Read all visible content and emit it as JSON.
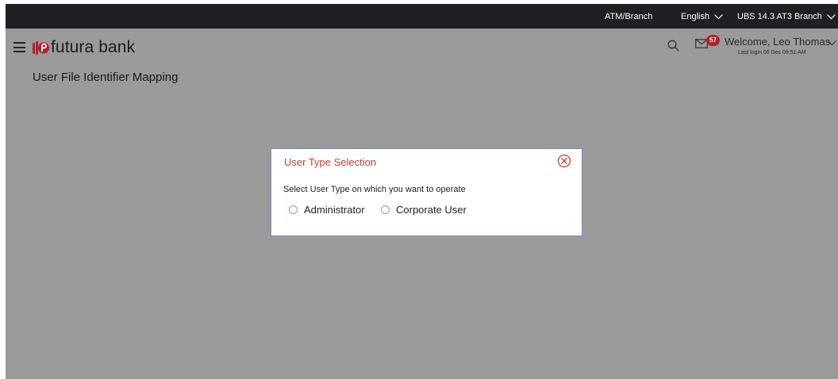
{
  "topbar": {
    "atm_branch": "ATM/Branch",
    "language": "English",
    "branch": "UBS 14.3 AT3 Branch"
  },
  "header": {
    "brand": "futura bank",
    "notification_count": "57",
    "welcome": "Welcome, Leo Thomas",
    "last_login": "Last login 06 Dec 09:51 AM",
    "icons": [
      "menu-icon",
      "logo-icon",
      "search-icon",
      "mail-icon",
      "chevron-down-icon"
    ]
  },
  "page": {
    "title": "User File Identifier Mapping"
  },
  "modal": {
    "title": "User Type Selection",
    "description": "Select User Type on which you want to operate",
    "options": [
      "Administrator",
      "Corporate User"
    ],
    "accent_color": "#c4402f"
  },
  "colors": {
    "topbar": "#1f1f24",
    "overlay": "#9a9a9a",
    "badge": "#b3212c",
    "modal_border": "#6f8fd0"
  }
}
